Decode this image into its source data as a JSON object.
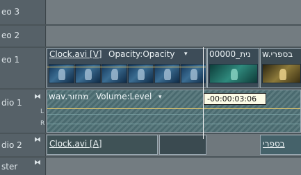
{
  "tracks": {
    "video3": {
      "name": "eo 3"
    },
    "video2": {
      "name": "eo 2"
    },
    "video1": {
      "name": "eo 1",
      "clip_a_title": "Clock.avi [V]",
      "clip_a_effect": "Opacity:Opacity",
      "clip_b_title": "00000_נית",
      "clip_c_title": "w.בספרי"
    },
    "audio1": {
      "name": "dio 1",
      "l_label": "L",
      "r_label": "R",
      "clip_title": "wav.מחזור",
      "clip_effect": "Volume:Level"
    },
    "audio2": {
      "name": "dio 2",
      "clip_a_title": "Clock.avi [A]",
      "clip_c_title": "בספרי"
    },
    "master": {
      "name": "ster"
    }
  },
  "tooltip": {
    "time": "-00:00:03:06"
  },
  "icons": [
    "dropdown-arrow-icon",
    "keyframe-toggle-icon",
    "speaker-icon"
  ]
}
